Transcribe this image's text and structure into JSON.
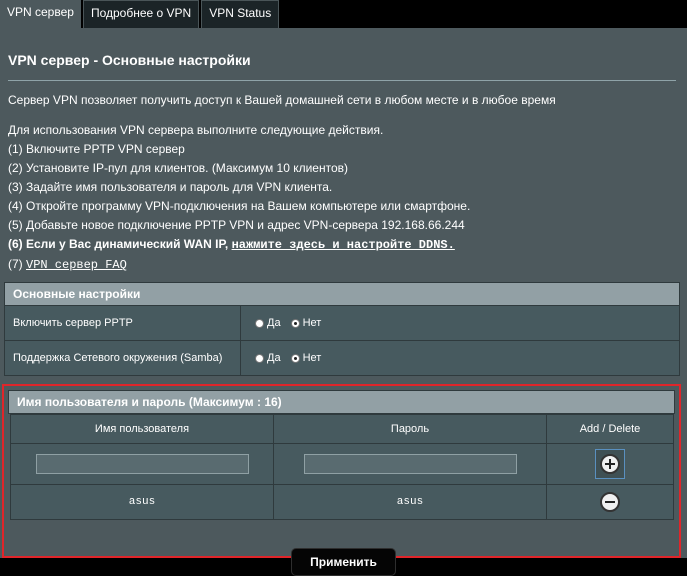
{
  "tabs": [
    {
      "label": "VPN сервер",
      "active": true
    },
    {
      "label": "Подробнее о VPN",
      "active": false
    },
    {
      "label": "VPN Status",
      "active": false
    }
  ],
  "title": "VPN сервер - Основные настройки",
  "intro": "Сервер VPN позволяет получить доступ к Вашей домашней сети в любом месте и в любое время",
  "steps": {
    "header": "Для использования VPN сервера выполните следующие действия.",
    "s1": "(1) Включите PPTP VPN сервер",
    "s2": "(2) Установите IP-пул для клиентов. (Максимум 10 клиентов)",
    "s3": "(3) Задайте имя пользователя и пароль для VPN клиента.",
    "s4": "(4) Откройте программу VPN-подключения на Вашем компьютере или смартфоне.",
    "s5": "(5) Добавьте новое подключение PPTP VPN и адрес VPN-сервера 192.168.66.244",
    "s6_text": "(6) Если у Вас динамический WAN IP, ",
    "s6_link": "нажмите здесь и настройте DDNS.",
    "s7_text": "(7) ",
    "s7_link": "VPN сервер FAQ"
  },
  "basic": {
    "header": "Основные настройки",
    "rows": [
      {
        "label": "Включить сервер PPTP",
        "yes": "Да",
        "no": "Нет",
        "selected": "no"
      },
      {
        "label": "Поддержка Сетевого окружения (Samba)",
        "yes": "Да",
        "no": "Нет",
        "selected": "no"
      }
    ]
  },
  "users": {
    "header": "Имя пользователя и пароль (Максимум : 16)",
    "col_user": "Имя пользователя",
    "col_pass": "Пароль",
    "col_action": "Add / Delete",
    "new_user": "",
    "new_pass": "",
    "entries": [
      {
        "user": "asus",
        "pass": "asus"
      }
    ]
  },
  "apply_label": "Применить",
  "colors": {
    "highlight_border": "#e0252a",
    "panel": "#4d595d",
    "section_head": "#92a0a5"
  }
}
